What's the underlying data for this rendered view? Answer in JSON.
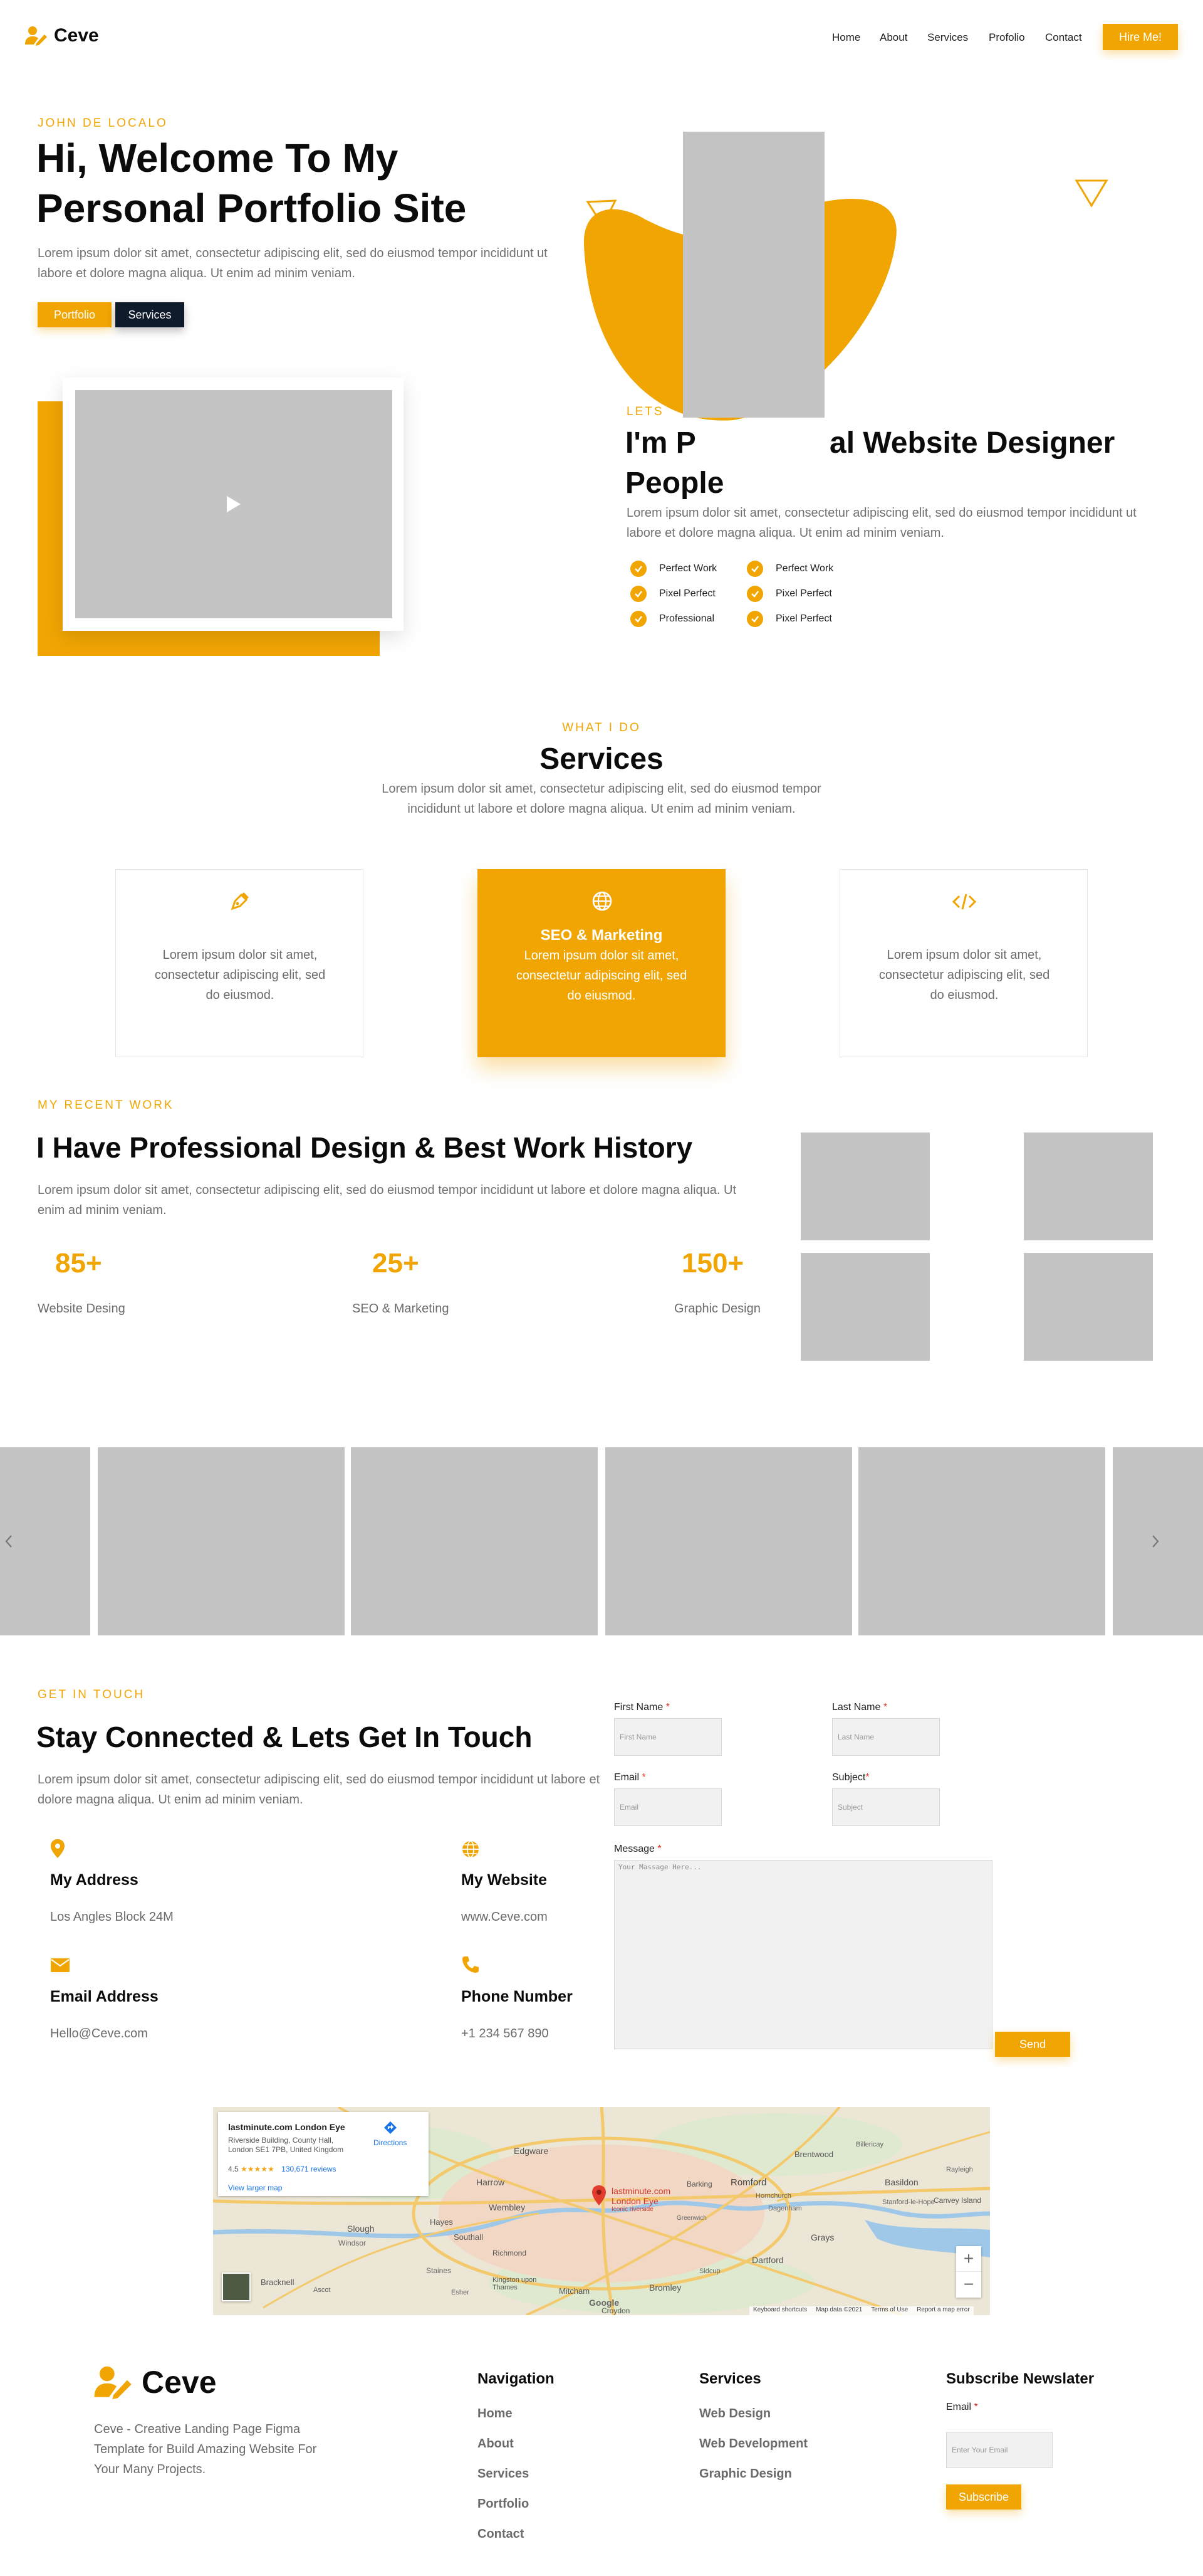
{
  "header": {
    "brand": "Ceve",
    "nav": [
      "Home",
      "About",
      "Services",
      "Profolio",
      "Contact"
    ],
    "cta": "Hire Me!"
  },
  "hero": {
    "eyebrow": "JOHN DE LOCALO",
    "title_line1": "Hi, Welcome To My",
    "title_line2": "Personal Portfolio Site",
    "text": "Lorem ipsum dolor sit amet, consectetur adipiscing elit, sed do eiusmod tempor incididunt ut labore et dolore magna aliqua. Ut enim ad minim veniam.",
    "btn_portfolio": "Portfolio",
    "btn_services": "Services"
  },
  "about": {
    "eyebrow": "LETS",
    "title_line1_a": "I'm P",
    "title_line1_b": "al Website Designer",
    "title_line2": "People",
    "text": "Lorem ipsum dolor sit amet, consectetur adipiscing elit, sed do eiusmod tempor incididunt ut labore et dolore magna aliqua. Ut enim ad minim veniam.",
    "checks_left": [
      "Perfect Work",
      "Pixel Perfect",
      "Professional"
    ],
    "checks_right": [
      "Perfect Work",
      "Pixel Perfect",
      "Pixel Perfect"
    ]
  },
  "services": {
    "eyebrow": "WHAT I DO",
    "title": "Services",
    "text": "Lorem ipsum dolor sit amet, consectetur adipiscing elit, sed do eiusmod tempor incididunt ut labore et dolore magna aliqua. Ut enim ad minim veniam.",
    "cards": [
      {
        "icon": "pen-icon",
        "title": "",
        "text": "Lorem ipsum dolor sit amet, consectetur adipiscing elit, sed do eiusmod."
      },
      {
        "icon": "globe-icon",
        "title": "SEO & Marketing",
        "text": "Lorem ipsum dolor sit amet, consectetur adipiscing elit, sed do eiusmod."
      },
      {
        "icon": "code-icon",
        "title": "",
        "text": "Lorem ipsum dolor sit amet, consectetur adipiscing elit, sed do eiusmod."
      }
    ]
  },
  "work": {
    "eyebrow": "MY RECENT WORK",
    "title": "I Have Professional Design & Best Work History",
    "text": "Lorem ipsum dolor sit amet, consectetur adipiscing elit, sed do eiusmod tempor incididunt ut labore et dolore magna aliqua. Ut enim ad minim veniam.",
    "stats": [
      {
        "num": "85+",
        "label": "Website Desing"
      },
      {
        "num": "25+",
        "label": "SEO & Marketing"
      },
      {
        "num": "150+",
        "label": "Graphic Design"
      }
    ]
  },
  "contact": {
    "eyebrow": "GET IN TOUCH",
    "title": "Stay Connected & Lets Get In Touch",
    "text": "Lorem ipsum dolor sit amet, consectetur adipiscing elit, sed do eiusmod tempor incididunt ut labore et dolore magna aliqua. Ut enim ad minim veniam.",
    "address_title": "My Address",
    "address_val": "Los Angles Block 24M",
    "website_title": "My Website",
    "website_val": "www.Ceve.com",
    "email_title": "Email Address",
    "email_val": "Hello@Ceve.com",
    "phone_title": "Phone Number",
    "phone_val": "+1 234 567 890",
    "form": {
      "first_label": "First Name",
      "first_ph": "First Name",
      "last_label": "Last Name",
      "last_ph": "Last Name",
      "email_label": "Email",
      "email_ph": "Email",
      "subject_label": "Subject",
      "subject_ph": "Subject",
      "message_label": "Message",
      "message_ph": "Your Massage Here...",
      "send": "Send",
      "req": "*"
    }
  },
  "map": {
    "place": "lastminute.com London Eye",
    "address": "Riverside Building, County Hall, London SE1 7PB, United Kingdom",
    "rating": "4.5",
    "stars": "★★★★★",
    "reviews": "130,671 reviews",
    "directions": "Directions",
    "larger": "View larger map",
    "pin_label_1": "lastminute.com",
    "pin_label_2": "London Eye",
    "pin_sub": "Iconic riverside",
    "towns": [
      "Edgware",
      "Harrow",
      "Wembley",
      "Romford",
      "Hornchurch",
      "Brentwood",
      "Billericay",
      "Basildon",
      "Rayleigh",
      "Southall",
      "Hayes",
      "Slough",
      "Windsor",
      "Staines",
      "Richmond",
      "Kingston upon Thames",
      "Bromley",
      "Croydon",
      "Mitcham",
      "Dartford",
      "Grays",
      "Sidcup",
      "Barking",
      "Dagenham",
      "Canvey Island",
      "Stanford-le-Hope",
      "Bracknell",
      "Ascot",
      "Esher",
      "Greenwich"
    ],
    "footer_a": "Keyboard shortcuts",
    "footer_b": "Map data ©2021",
    "footer_c": "Terms of Use",
    "footer_d": "Report a map error",
    "google": "Google",
    "zoom_in": "+",
    "zoom_out": "−"
  },
  "footer": {
    "brand": "Ceve",
    "desc": "Ceve - Creative Landing Page Figma Template for Build Amazing Website For Your Many Projects.",
    "nav_title": "Navigation",
    "nav": [
      "Home",
      "About",
      "Services",
      "Portfolio",
      "Contact"
    ],
    "svc_title": "Services",
    "svc": [
      "Web Design",
      "Web Development",
      "Graphic Design"
    ],
    "sub_title": "Subscribe Newslater",
    "sub_label": "Email",
    "sub_ph": "Enter Your Email",
    "sub_btn": "Subscribe",
    "req": "*"
  },
  "colors": {
    "accent": "#f0a503",
    "dark": "#0f1b2b",
    "placeholder": "#c4c4c4"
  },
  "icons": [
    "user-pen-icon",
    "play-icon",
    "check-icon",
    "pen-icon",
    "globe-icon",
    "code-icon",
    "chevron-left-icon",
    "chevron-right-icon",
    "location-pin-icon",
    "envelope-icon",
    "phone-icon"
  ]
}
